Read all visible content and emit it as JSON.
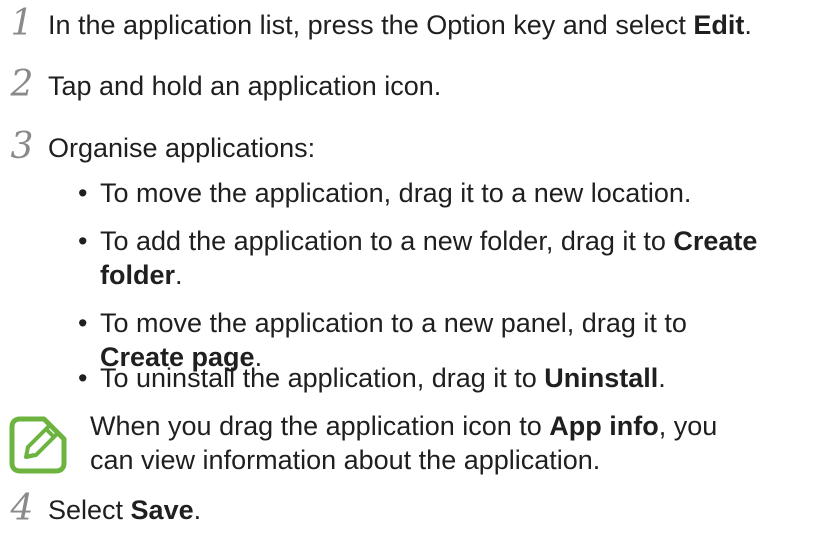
{
  "steps": [
    {
      "num": "1",
      "pre": "In the application list, press the Option key and select ",
      "bold": "Edit",
      "post": "."
    },
    {
      "num": "2",
      "text": "Tap and hold an application icon."
    },
    {
      "num": "3",
      "text": "Organise applications:"
    },
    {
      "num": "4",
      "pre": "Select ",
      "bold": "Save",
      "post": "."
    }
  ],
  "bullets": [
    {
      "dot": "•",
      "line1": "To move the application, drag it to a new location."
    },
    {
      "dot": "•",
      "pre": "To add the application to a new folder, drag it to ",
      "bold1": "Create",
      "bold2": "folder",
      "post": "."
    },
    {
      "dot": "•",
      "pre": "To move the application to a new panel, drag it to",
      "bold": "Create page",
      "post": "."
    },
    {
      "dot": "•",
      "pre": "To uninstall the application, drag it to ",
      "bold": "Uninstall",
      "post": "."
    }
  ],
  "note": {
    "icon": "note-pencil-icon",
    "pre": "When you drag the application icon to ",
    "bold": "App info",
    "post1": ", you",
    "line2": "can view information about the application."
  },
  "colors": {
    "step_number": "#8a8a8a",
    "icon_green": "#6db33f",
    "text": "#1f1f1f"
  }
}
